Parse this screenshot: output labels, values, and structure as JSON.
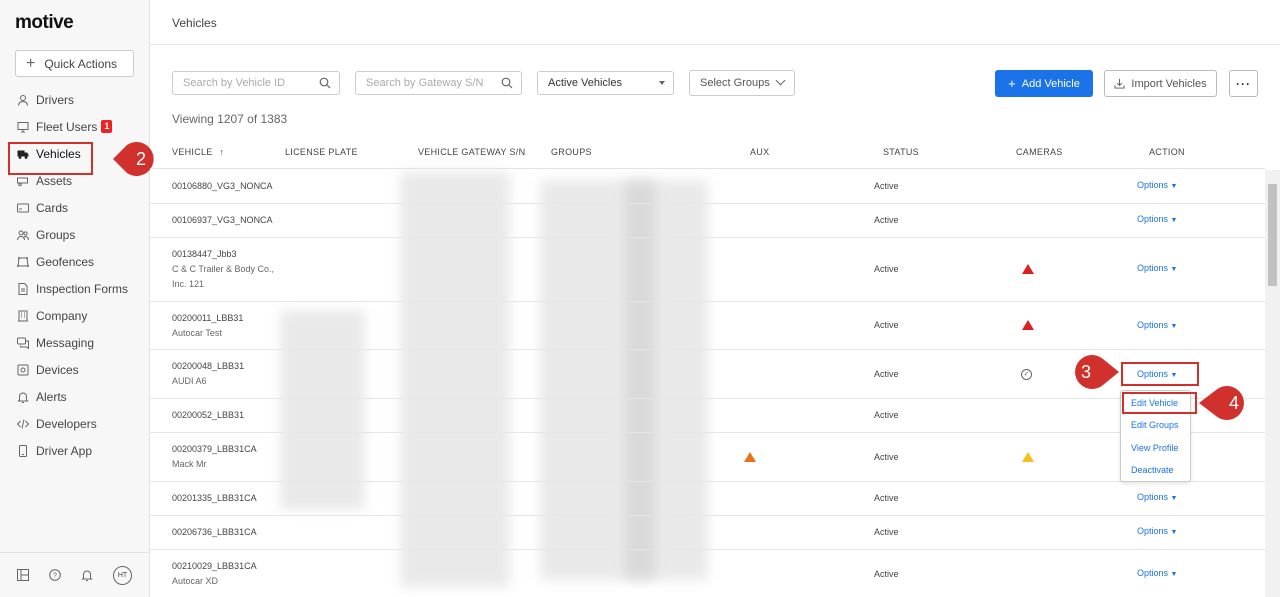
{
  "app": {
    "logo": "motive",
    "page_title": "Vehicles"
  },
  "sidebar": {
    "quick_actions": "Quick Actions",
    "items": [
      {
        "label": "Drivers",
        "icon": "person-icon"
      },
      {
        "label": "Fleet Users",
        "icon": "monitor-icon",
        "badge": "1"
      },
      {
        "label": "Vehicles",
        "icon": "truck-icon"
      },
      {
        "label": "Assets",
        "icon": "trailer-icon"
      },
      {
        "label": "Cards",
        "icon": "card-icon"
      },
      {
        "label": "Groups",
        "icon": "groups-icon"
      },
      {
        "label": "Geofences",
        "icon": "geofence-icon"
      },
      {
        "label": "Inspection Forms",
        "icon": "document-icon"
      },
      {
        "label": "Company",
        "icon": "building-icon"
      },
      {
        "label": "Messaging",
        "icon": "chat-icon"
      },
      {
        "label": "Devices",
        "icon": "devices-icon"
      },
      {
        "label": "Alerts",
        "icon": "bell-icon"
      },
      {
        "label": "Developers",
        "icon": "code-icon"
      },
      {
        "label": "Driver App",
        "icon": "phone-icon"
      }
    ],
    "bottom_avatar": "HT"
  },
  "filters": {
    "vehicle_id_placeholder": "Search by Vehicle ID",
    "gateway_placeholder": "Search by Gateway S/N",
    "status_select": "Active Vehicles",
    "groups_select": "Select Groups",
    "add_vehicle": "Add Vehicle",
    "import_vehicles": "Import Vehicles",
    "more": "···"
  },
  "viewing": "Viewing 1207 of 1383",
  "table": {
    "headers": {
      "vehicle": "VEHICLE",
      "sort_arrow": "↑",
      "license_plate": "LICENSE PLATE",
      "gateway": "VEHICLE GATEWAY S/N",
      "groups": "GROUPS",
      "aux": "AUX",
      "status": "STATUS",
      "cameras": "CAMERAS",
      "action": "ACTION"
    },
    "rows": [
      {
        "vehicle": "00106880_VG3_NONCA",
        "sub1": "",
        "sub2": "",
        "status": "Active",
        "camera": "",
        "aux": "",
        "action": "Options"
      },
      {
        "vehicle": "00106937_VG3_NONCA",
        "sub1": "",
        "sub2": "",
        "status": "Active",
        "camera": "",
        "aux": "",
        "action": "Options"
      },
      {
        "vehicle": "00138447_Jbb3",
        "sub1": "C & C Trailer & Body Co.,",
        "sub2": "Inc. 121",
        "status": "Active",
        "camera": "red-warning",
        "aux": "",
        "action": "Options"
      },
      {
        "vehicle": "00200011_LBB31",
        "sub1": "Autocar Test",
        "sub2": "",
        "status": "Active",
        "camera": "red-warning",
        "aux": "",
        "action": "Options"
      },
      {
        "vehicle": "00200048_LBB31",
        "sub1": "AUDI A6",
        "sub2": "",
        "status": "Active",
        "camera": "check",
        "aux": "",
        "action": "Options"
      },
      {
        "vehicle": "00200052_LBB31",
        "sub1": "",
        "sub2": "",
        "status": "Active",
        "camera": "",
        "aux": "",
        "action": ""
      },
      {
        "vehicle": "00200379_LBB31CA",
        "sub1": "Mack Mr",
        "sub2": "",
        "status": "Active",
        "camera": "yellow-warning",
        "aux": "orange-warning",
        "action": ""
      },
      {
        "vehicle": "00201335_LBB31CA",
        "sub1": "",
        "sub2": "",
        "status": "Active",
        "camera": "",
        "aux": "",
        "action": "Options"
      },
      {
        "vehicle": "00206736_LBB31CA",
        "sub1": "",
        "sub2": "",
        "status": "Active",
        "camera": "",
        "aux": "",
        "action": "Options"
      },
      {
        "vehicle": "00210029_LBB31CA",
        "sub1": "Autocar XD",
        "sub2": "",
        "status": "Active",
        "camera": "",
        "aux": "",
        "action": "Options"
      }
    ]
  },
  "dropdown": {
    "items": [
      "Edit Vehicle",
      "Edit Groups",
      "View Profile",
      "Deactivate"
    ]
  },
  "annotations": {
    "step2": "2",
    "step3": "3",
    "step4": "4"
  },
  "colors": {
    "primary": "#1a73e8",
    "annotation": "#d0312d",
    "warning_red": "#d92020",
    "warning_orange": "#e8731a",
    "warning_yellow": "#f3c21b"
  }
}
